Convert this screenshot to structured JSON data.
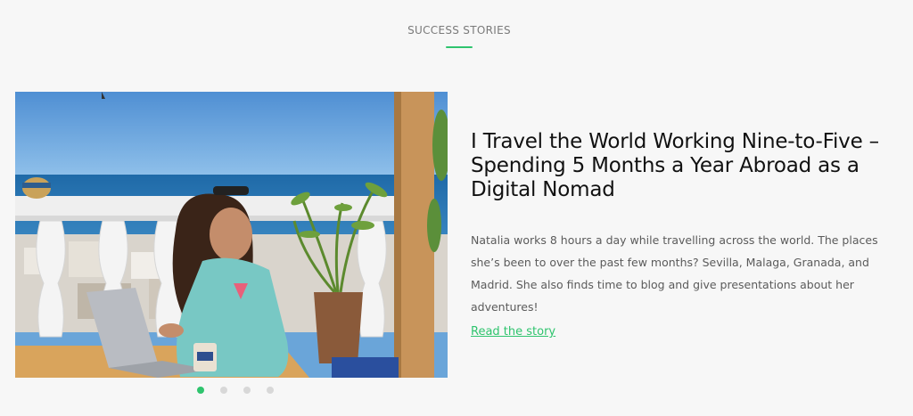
{
  "section": {
    "label": "SUCCESS STORIES",
    "accent_color": "#2fc46e"
  },
  "story": {
    "image_icon": "woman-working-on-laptop-terrace-photo",
    "title": "I Travel the World Working Nine-to-Five – Spending 5 Months a Year Abroad as a Digital Nomad",
    "excerpt": "Natalia works 8 hours a day while travelling across the world. The places she’s been to over the past few months? Sevilla, Malaga, Granada, and Madrid. She also finds time to blog and give presentations about her adventures!",
    "link_label": "Read the story",
    "link_color": "#2fc46e"
  },
  "pager": {
    "count": 4,
    "active_index": 0
  }
}
